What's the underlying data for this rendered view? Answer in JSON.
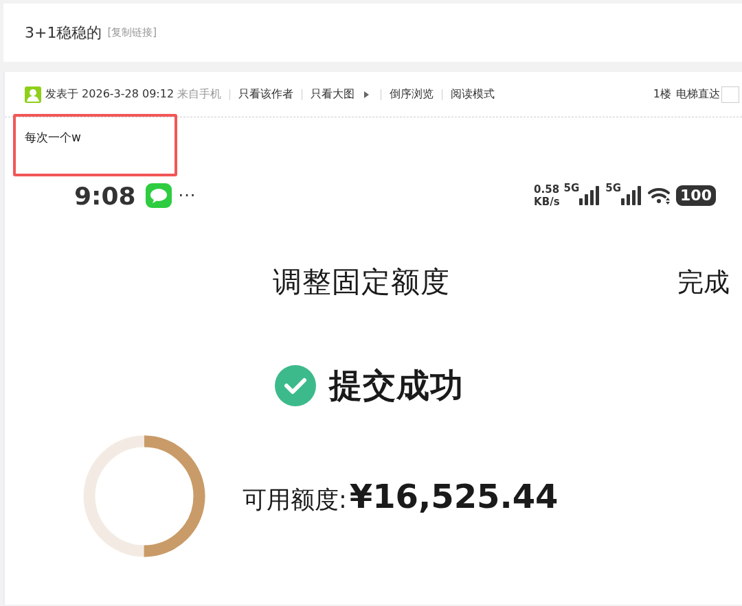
{
  "thread": {
    "title": "3+1稳稳的",
    "copy_link": "[复制链接]"
  },
  "post": {
    "posted": "发表于 2026-3-28 09:12",
    "source": "来自手机",
    "actions": [
      {
        "label": "只看该作者",
        "kind": "link"
      },
      {
        "label": "只看大图",
        "kind": "menu"
      },
      {
        "label": "倒序浏览",
        "kind": "link"
      },
      {
        "label": "阅读模式",
        "kind": "link"
      }
    ],
    "floor": "1楼",
    "jump_label": "电梯直达",
    "body": "每次一个w",
    "body_highlighted": true
  },
  "screenshot": {
    "time": "9:08",
    "more": "···",
    "speed_value": "0.58",
    "speed_unit": "KB/s",
    "networks": [
      "5G",
      "5G"
    ],
    "battery": "100",
    "heading": "调整固定额度",
    "done": "完成",
    "status": "提交成功",
    "gauge": {
      "level": 0.5
    },
    "available_label": "可用额度:",
    "available_amount": "¥16,525.44"
  }
}
